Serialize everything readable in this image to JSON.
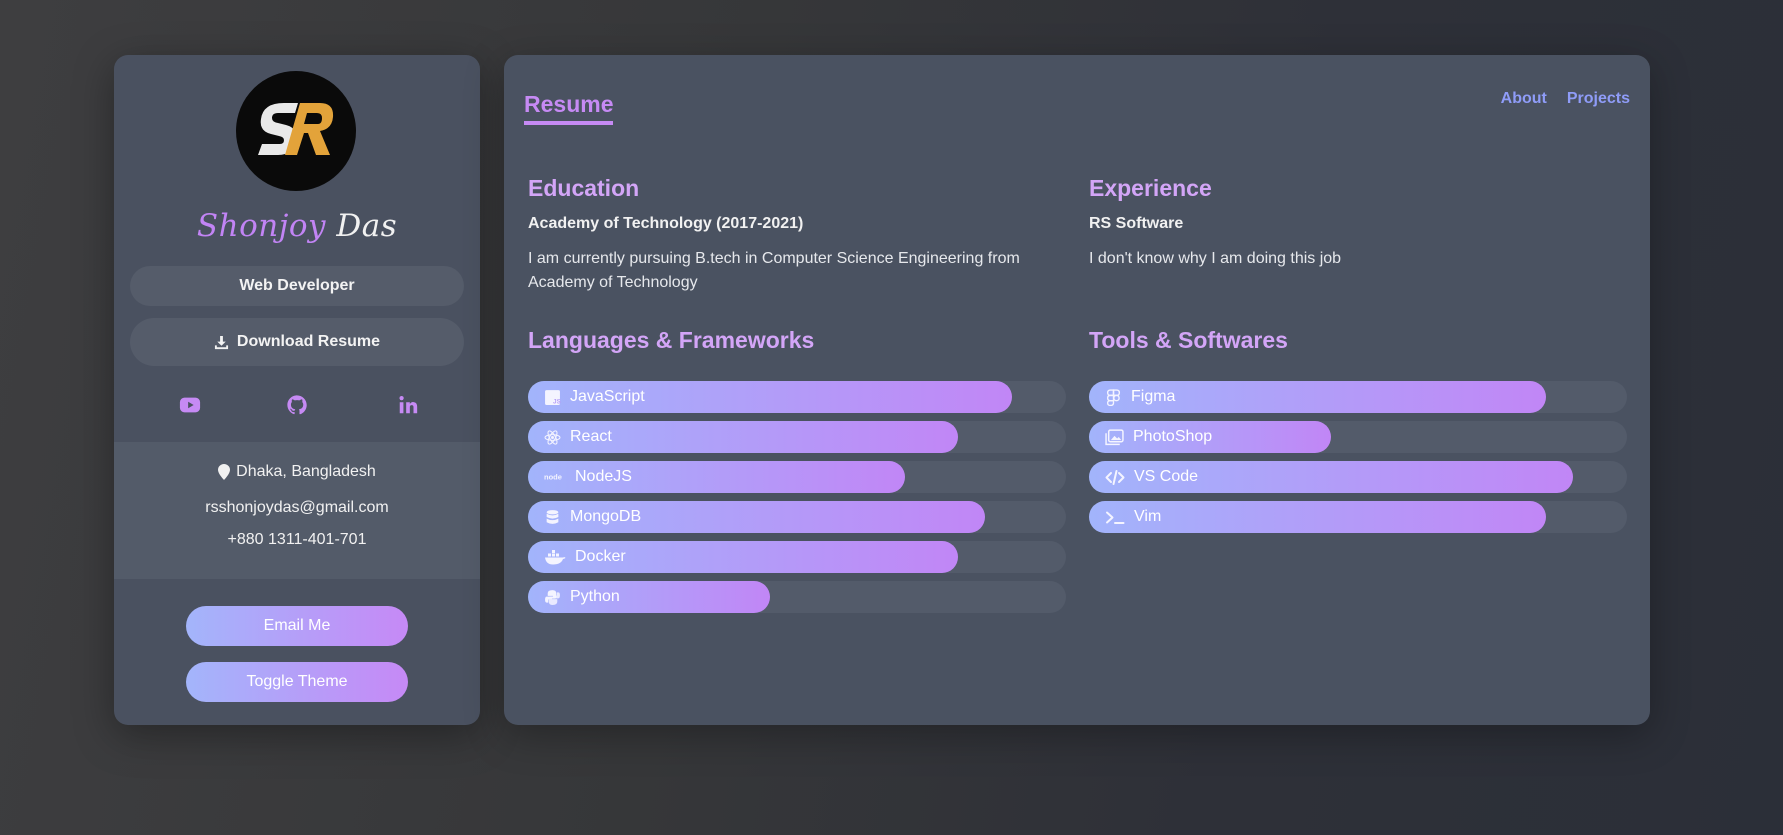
{
  "profile": {
    "logo_text": "SR",
    "first_name": "Shonjoy",
    "last_name": "Das",
    "role": "Web Developer",
    "download_label": "Download Resume",
    "socials": [
      {
        "name": "youtube-icon"
      },
      {
        "name": "github-icon"
      },
      {
        "name": "linkedin-icon"
      }
    ],
    "location": "Dhaka, Bangladesh",
    "email": "rsshonjoydas@gmail.com",
    "phone": "+880 1311-401-701",
    "email_button": "Email Me",
    "theme_button": "Toggle Theme"
  },
  "header": {
    "title": "Resume",
    "nav": [
      "About",
      "Projects"
    ]
  },
  "education": {
    "heading": "Education",
    "title": "Academy of Technology (2017-2021)",
    "text": "I am currently pursuing B.tech in Computer Science Engineering from Academy of Technology"
  },
  "experience": {
    "heading": "Experience",
    "title": "RS Software",
    "text": "I don't know why I am doing this job"
  },
  "languages": {
    "heading": "Languages & Frameworks",
    "items": [
      {
        "label": "JavaScript",
        "icon": "javascript-icon",
        "level": 0.9
      },
      {
        "label": "React",
        "icon": "react-icon",
        "level": 0.8
      },
      {
        "label": "NodeJS",
        "icon": "nodejs-icon",
        "level": 0.7
      },
      {
        "label": "MongoDB",
        "icon": "database-icon",
        "level": 0.85
      },
      {
        "label": "Docker",
        "icon": "docker-icon",
        "level": 0.8
      },
      {
        "label": "Python",
        "icon": "python-icon",
        "level": 0.45
      }
    ]
  },
  "tools": {
    "heading": "Tools & Softwares",
    "items": [
      {
        "label": "Figma",
        "icon": "figma-icon",
        "level": 0.85
      },
      {
        "label": "PhotoShop",
        "icon": "image-icon",
        "level": 0.45
      },
      {
        "label": "VS Code",
        "icon": "code-icon",
        "level": 0.9
      },
      {
        "label": "Vim",
        "icon": "terminal-icon",
        "level": 0.85
      }
    ]
  },
  "colors": {
    "accent": "#c68af4",
    "nav_link": "#8f9cf8",
    "gradient_start": "#a2b4fb",
    "gradient_end": "#c186f6"
  }
}
